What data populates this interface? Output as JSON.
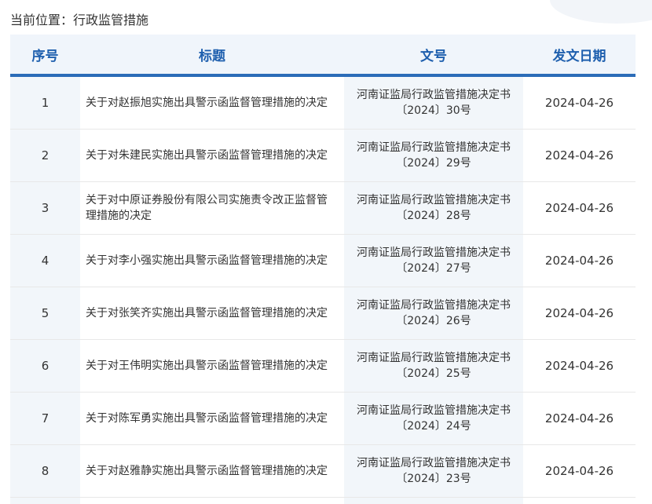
{
  "breadcrumb": "当前位置：行政监管措施",
  "table": {
    "headers": {
      "index": "序号",
      "title": "标题",
      "doc_no": "文号",
      "date": "发文日期"
    },
    "rows": [
      {
        "index": "1",
        "title": "关于对赵振旭实施出具警示函监督管理措施的决定",
        "doc_no_line1": "河南证监局行政监管措施决定书",
        "doc_no_line2": "〔2024〕30号",
        "date": "2024-04-26"
      },
      {
        "index": "2",
        "title": "关于对朱建民实施出具警示函监督管理措施的决定",
        "doc_no_line1": "河南证监局行政监管措施决定书",
        "doc_no_line2": "〔2024〕29号",
        "date": "2024-04-26"
      },
      {
        "index": "3",
        "title": "关于对中原证券股份有限公司实施责令改正监督管理措施的决定",
        "doc_no_line1": "河南证监局行政监管措施决定书",
        "doc_no_line2": "〔2024〕28号",
        "date": "2024-04-26"
      },
      {
        "index": "4",
        "title": "关于对李小强实施出具警示函监督管理措施的决定",
        "doc_no_line1": "河南证监局行政监管措施决定书",
        "doc_no_line2": "〔2024〕27号",
        "date": "2024-04-26"
      },
      {
        "index": "5",
        "title": "关于对张笑齐实施出具警示函监督管理措施的决定",
        "doc_no_line1": "河南证监局行政监管措施决定书",
        "doc_no_line2": "〔2024〕26号",
        "date": "2024-04-26"
      },
      {
        "index": "6",
        "title": "关于对王伟明实施出具警示函监督管理措施的决定",
        "doc_no_line1": "河南证监局行政监管措施决定书",
        "doc_no_line2": "〔2024〕25号",
        "date": "2024-04-26"
      },
      {
        "index": "7",
        "title": "关于对陈军勇实施出具警示函监督管理措施的决定",
        "doc_no_line1": "河南证监局行政监管措施决定书",
        "doc_no_line2": "〔2024〕24号",
        "date": "2024-04-26"
      },
      {
        "index": "8",
        "title": "关于对赵雅静实施出具警示函监督管理措施的决定",
        "doc_no_line1": "河南证监局行政监管措施决定书",
        "doc_no_line2": "〔2024〕23号",
        "date": "2024-04-26"
      }
    ]
  },
  "colors": {
    "header_text": "#1e5fae",
    "header_rule": "#2b6cb8",
    "shaded_column": "#f2f6fa"
  }
}
